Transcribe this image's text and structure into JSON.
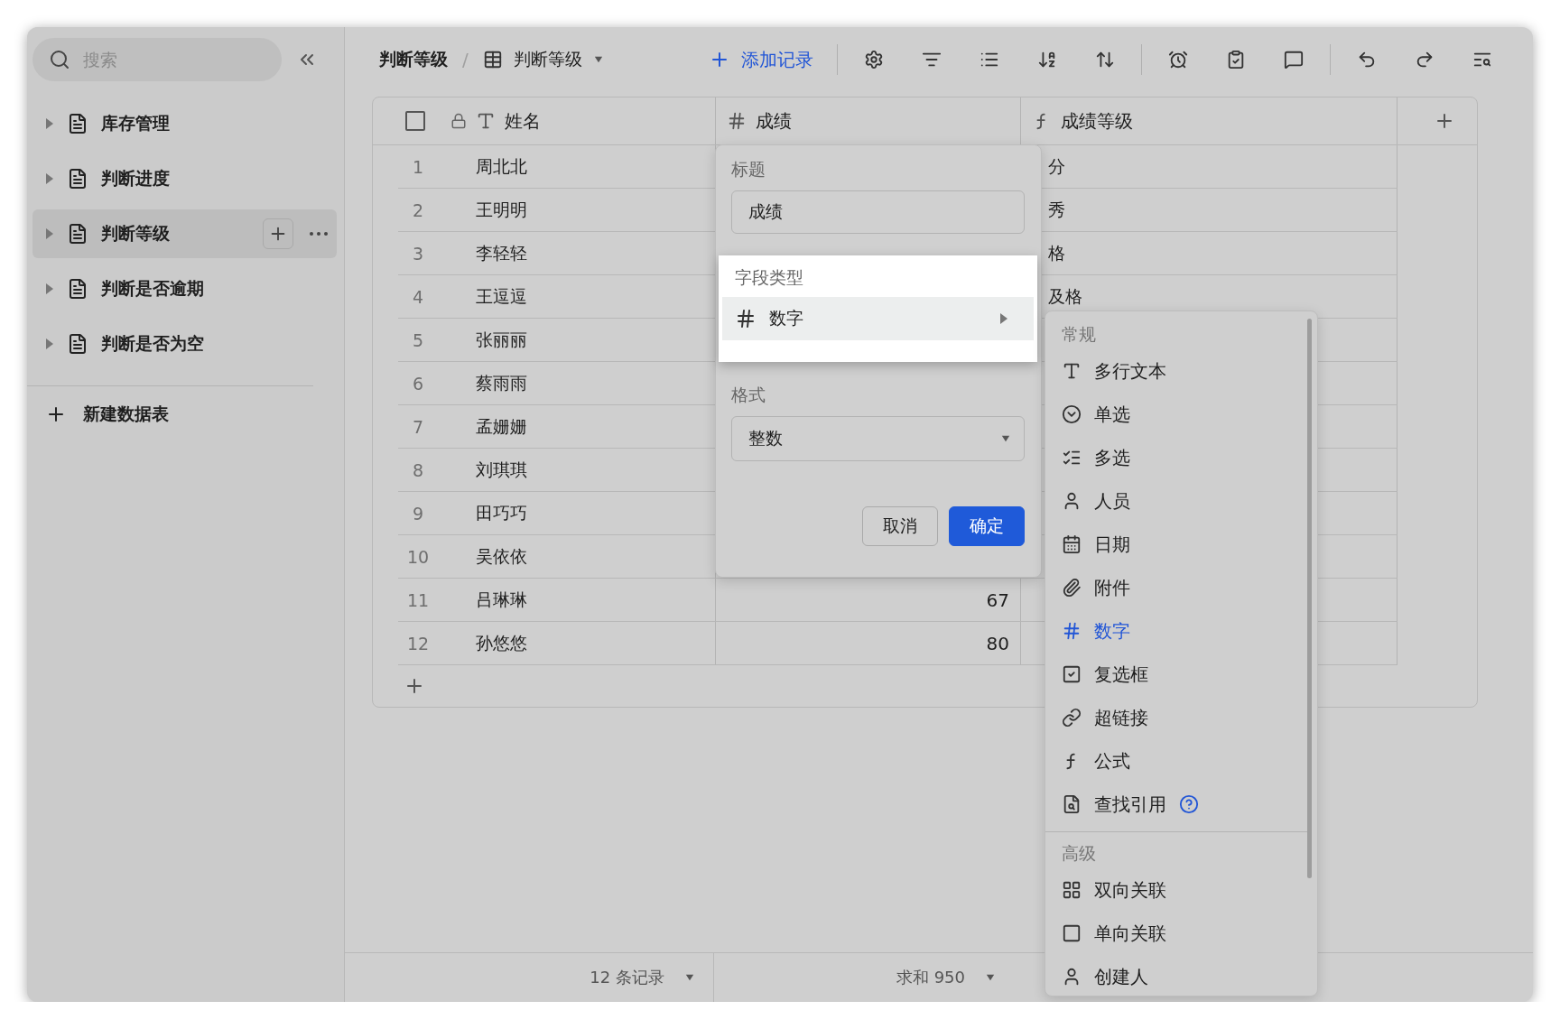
{
  "sidebar": {
    "search": {
      "placeholder": "搜索"
    },
    "items": [
      {
        "label": "库存管理",
        "selected": false
      },
      {
        "label": "判断进度",
        "selected": false
      },
      {
        "label": "判断等级",
        "selected": true
      },
      {
        "label": "判断是否逾期",
        "selected": false
      },
      {
        "label": "判断是否为空",
        "selected": false
      }
    ],
    "new_table": "新建数据表"
  },
  "toolbar": {
    "breadcrumb": "判断等级",
    "separator": "/",
    "view": "判断等级",
    "add_record": "添加记录"
  },
  "table": {
    "select_all": {
      "checked": false
    },
    "columns": [
      {
        "kind": "text",
        "label": "姓名",
        "locked": true
      },
      {
        "kind": "number",
        "label": "成绩",
        "locked": false
      },
      {
        "kind": "formula",
        "label": "成绩等级",
        "locked": false
      }
    ],
    "rows": [
      {
        "index": "1",
        "name": "周北北",
        "grade": "分"
      },
      {
        "index": "2",
        "name": "王明明",
        "grade": "秀"
      },
      {
        "index": "3",
        "name": "李轻轻",
        "grade": "格"
      },
      {
        "index": "4",
        "name": "王逗逗",
        "grade": "及格"
      },
      {
        "index": "5",
        "name": "张丽丽"
      },
      {
        "index": "6",
        "name": "蔡雨雨"
      },
      {
        "index": "7",
        "name": "孟姗姗"
      },
      {
        "index": "8",
        "name": "刘琪琪"
      },
      {
        "index": "9",
        "name": "田巧巧"
      },
      {
        "index": "10",
        "name": "吴依依"
      },
      {
        "index": "11",
        "name": "吕琳琳",
        "score": "67"
      },
      {
        "index": "12",
        "name": "孙悠悠",
        "score": "80"
      }
    ]
  },
  "footer": {
    "count": "12 条记录",
    "sum": "求和 950"
  },
  "field_editor": {
    "title_label": "标题",
    "title_value": "成绩",
    "type_label": "字段类型",
    "type_value": "数字",
    "format_label": "格式",
    "format_value": "整数",
    "buttons": [
      {
        "label": "取消",
        "kind": "secondary"
      },
      {
        "label": "确定",
        "kind": "primary"
      }
    ]
  },
  "type_menu": {
    "sections": [
      {
        "title": "常规",
        "items": [
          {
            "label": "多行文本",
            "selected": false,
            "help": false
          },
          {
            "label": "单选",
            "selected": false,
            "help": false
          },
          {
            "label": "多选",
            "selected": false,
            "help": false
          },
          {
            "label": "人员",
            "selected": false,
            "help": false
          },
          {
            "label": "日期",
            "selected": false,
            "help": false
          },
          {
            "label": "附件",
            "selected": false,
            "help": false
          },
          {
            "label": "数字",
            "selected": true,
            "help": false
          },
          {
            "label": "复选框",
            "selected": false,
            "help": false
          },
          {
            "label": "超链接",
            "selected": false,
            "help": false
          },
          {
            "label": "公式",
            "selected": false,
            "help": false
          },
          {
            "label": "查找引用",
            "selected": false,
            "help": true
          }
        ]
      },
      {
        "title": "高级",
        "items": [
          {
            "label": "双向关联",
            "selected": false,
            "help": false
          },
          {
            "label": "单向关联",
            "selected": false,
            "help": false
          },
          {
            "label": "创建人",
            "selected": false,
            "help": false
          }
        ]
      }
    ]
  }
}
